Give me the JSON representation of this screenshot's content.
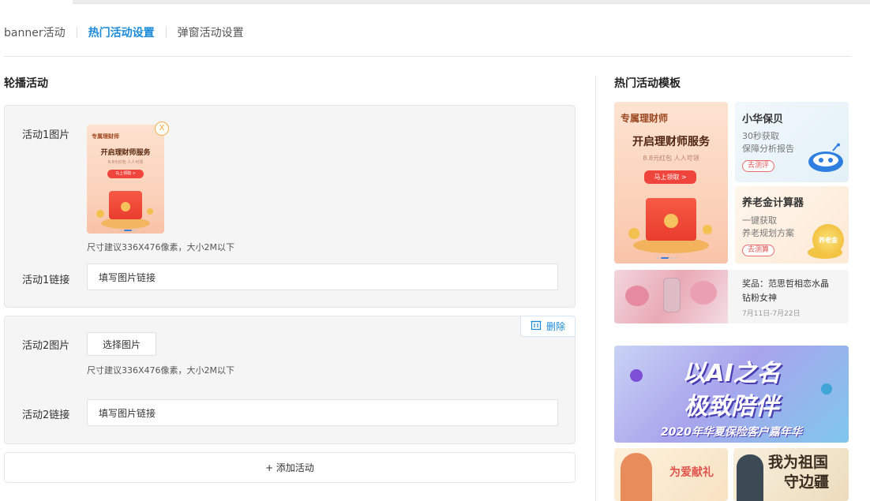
{
  "tabs": [
    {
      "label": "banner活动"
    },
    {
      "label": "热门活动设置"
    },
    {
      "label": "弹窗活动设置"
    }
  ],
  "left": {
    "title": "轮播活动",
    "activity1": {
      "image_label": "活动1图片",
      "close_glyph": "X",
      "thumb": {
        "tag": "专属理财师",
        "title": "开启理财师服务",
        "desc": "8.8元红包 人人可领",
        "button": "马上领取 >"
      },
      "hint": "尺寸建议336X476像素，大小2M以下",
      "link_label": "活动1链接",
      "link_placeholder": "填写图片链接"
    },
    "activity2": {
      "delete_label": "删除",
      "image_label": "活动2图片",
      "pick_label": "选择图片",
      "hint": "尺寸建议336X476像素，大小2M以下",
      "link_label": "活动2链接",
      "link_placeholder": "填写图片链接"
    },
    "add_label": "+ 添加活动"
  },
  "right": {
    "title": "热门活动模板",
    "t1": {
      "tag": "专属理财师",
      "title": "开启理财师服务",
      "desc": "8.8元红包 人人可领",
      "button": "马上领取 >"
    },
    "t2": {
      "title": "小华保贝",
      "line1": "30秒获取",
      "line2": "保障分析报告",
      "button": "去测评"
    },
    "t3": {
      "title": "养老金计算器",
      "line1": "一键获取",
      "line2": "养老规划方案",
      "button": "去测算",
      "coin_text": "养老金"
    },
    "t4": {
      "line1": "奖品：范思哲相恋水晶",
      "line2": "钻粉女神",
      "date": "7月11日-7月22日"
    },
    "banner": {
      "line1": "以AI之名",
      "line2": "极致陪伴",
      "line3": "2020年华夏保险客户嘉年华"
    },
    "b1": {
      "text": "为爱献礼"
    },
    "b2": {
      "line1": "我为祖国",
      "line2": "守边疆"
    }
  }
}
